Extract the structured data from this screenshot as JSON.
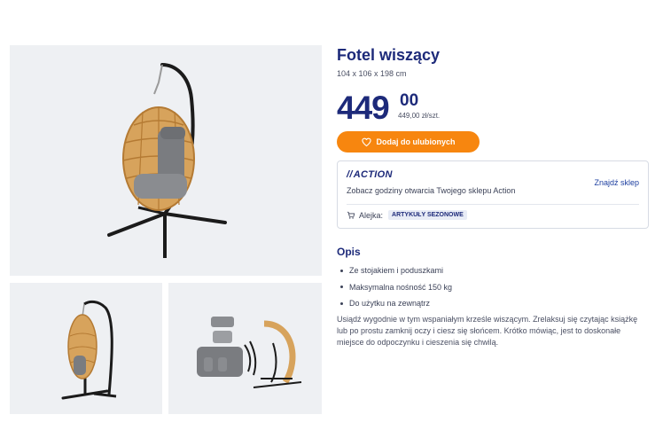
{
  "gallery": {
    "main_alt": "Fotel wiszący",
    "thumb_1_alt": "Fotel wiszący",
    "thumb_2_alt": "Fotel wiszący"
  },
  "product": {
    "title": "Fotel wiszący",
    "dimensions": "104 x 106 x 198 cm",
    "price_integer": "449",
    "price_decimal": "00",
    "price_unit": "449,00 zł/szt.",
    "favorite_button": "Dodaj do ulubionych"
  },
  "store": {
    "brand": "ACTION",
    "find_store": "Znajdź sklep",
    "hours_text": "Zobacz godziny otwarcia Twojego sklepu Action",
    "aisle_label": "Alejka:",
    "aisle_value": "ARTYKUŁY SEZONOWE"
  },
  "description": {
    "heading": "Opis",
    "features": [
      "Ze stojakiem i poduszkami",
      "Maksymalna nośność 150 kg",
      "Do użytku na zewnątrz"
    ],
    "text": "Usiądź wygodnie w tym wspaniałym krześle wiszącym. Zrelaksuj się czytając książkę lub po prostu zamknij oczy i ciesz się słońcem. Krótko mówiąc, jest to doskonałe miejsce do odpoczynku i cieszenia się chwilą."
  },
  "colors": {
    "brand_blue": "#1d2a7a",
    "accent_orange": "#f7860f",
    "image_bg": "#eef0f3"
  }
}
